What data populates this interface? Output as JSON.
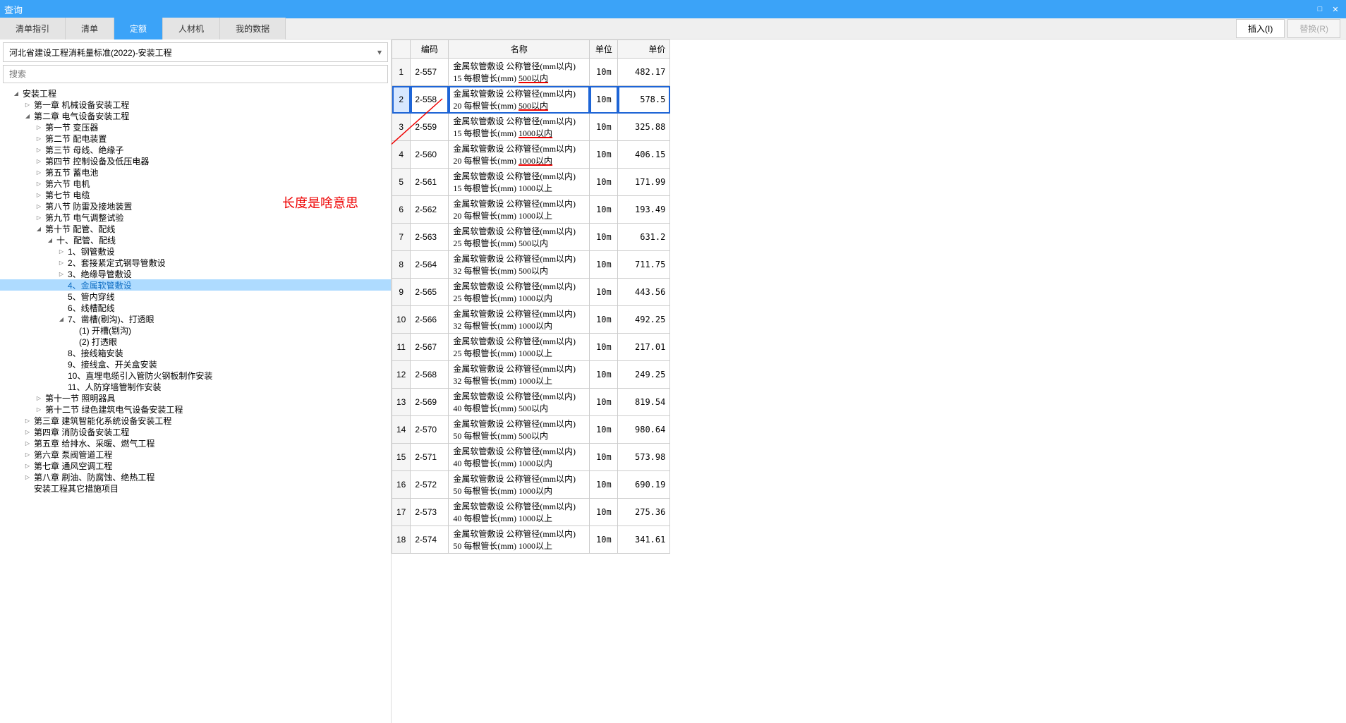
{
  "window": {
    "title": "查询"
  },
  "tabs": [
    "清单指引",
    "清单",
    "定额",
    "人材机",
    "我的数据"
  ],
  "active_tab": "定额",
  "actions": {
    "insert": "插入(I)",
    "replace": "替换(R)"
  },
  "dropdown": {
    "value": "河北省建设工程消耗量标准(2022)-安装工程"
  },
  "search": {
    "placeholder": "搜索"
  },
  "tree": [
    {
      "label": "安装工程",
      "depth": 0,
      "exp": true
    },
    {
      "label": "第一章 机械设备安装工程",
      "depth": 1,
      "exp": false
    },
    {
      "label": "第二章 电气设备安装工程",
      "depth": 1,
      "exp": true
    },
    {
      "label": "第一节 变压器",
      "depth": 2,
      "exp": false
    },
    {
      "label": "第二节 配电装置",
      "depth": 2,
      "exp": false
    },
    {
      "label": "第三节 母线、绝缘子",
      "depth": 2,
      "exp": false
    },
    {
      "label": "第四节 控制设备及低压电器",
      "depth": 2,
      "exp": false
    },
    {
      "label": "第五节 蓄电池",
      "depth": 2,
      "exp": false
    },
    {
      "label": "第六节 电机",
      "depth": 2,
      "exp": false
    },
    {
      "label": "第七节 电缆",
      "depth": 2,
      "exp": false
    },
    {
      "label": "第八节 防雷及接地装置",
      "depth": 2,
      "exp": false
    },
    {
      "label": "第九节 电气调整试验",
      "depth": 2,
      "exp": false
    },
    {
      "label": "第十节 配管、配线",
      "depth": 2,
      "exp": true
    },
    {
      "label": "十、配管、配线",
      "depth": 3,
      "exp": true
    },
    {
      "label": "1、钢管敷设",
      "depth": 4,
      "exp": false
    },
    {
      "label": "2、套接紧定式钢导管敷设",
      "depth": 4,
      "exp": false
    },
    {
      "label": "3、绝缘导管敷设",
      "depth": 4,
      "exp": false
    },
    {
      "label": "4、金属软管敷设",
      "depth": 4,
      "exp": false,
      "hl": true,
      "leaf": true
    },
    {
      "label": "5、管内穿线",
      "depth": 4,
      "exp": false,
      "leaf": true
    },
    {
      "label": "6、线槽配线",
      "depth": 4,
      "exp": false,
      "leaf": true
    },
    {
      "label": "7、凿槽(剔沟)、打透眼",
      "depth": 4,
      "exp": true
    },
    {
      "label": "(1) 开槽(剔沟)",
      "depth": 5,
      "exp": false,
      "leaf": true
    },
    {
      "label": "(2) 打透眼",
      "depth": 5,
      "exp": false,
      "leaf": true
    },
    {
      "label": "8、接线箱安装",
      "depth": 4,
      "exp": false,
      "leaf": true
    },
    {
      "label": "9、接线盒、开关盒安装",
      "depth": 4,
      "exp": false,
      "leaf": true
    },
    {
      "label": "10、直埋电缆引入管防火钢板制作安装",
      "depth": 4,
      "exp": false,
      "leaf": true
    },
    {
      "label": "11、人防穿墙管制作安装",
      "depth": 4,
      "exp": false,
      "leaf": true
    },
    {
      "label": "第十一节 照明器具",
      "depth": 2,
      "exp": false
    },
    {
      "label": "第十二节 绿色建筑电气设备安装工程",
      "depth": 2,
      "exp": false
    },
    {
      "label": "第三章 建筑智能化系统设备安装工程",
      "depth": 1,
      "exp": false
    },
    {
      "label": "第四章 消防设备安装工程",
      "depth": 1,
      "exp": false
    },
    {
      "label": "第五章 给排水、采暖、燃气工程",
      "depth": 1,
      "exp": false
    },
    {
      "label": "第六章 泵阀管道工程",
      "depth": 1,
      "exp": false
    },
    {
      "label": "第七章 通风空调工程",
      "depth": 1,
      "exp": false
    },
    {
      "label": "第八章 刷油、防腐蚀、绝热工程",
      "depth": 1,
      "exp": false
    },
    {
      "label": "安装工程其它措施项目",
      "depth": 1,
      "exp": false,
      "leaf": true
    }
  ],
  "table": {
    "headers": [
      "编码",
      "名称",
      "单位",
      "单价"
    ],
    "rows": [
      {
        "idx": 1,
        "code": "2-557",
        "name": "金属软管敷设 公称管径(mm以内) 15 每根管长(mm) ",
        "suffix": "500以内",
        "unit": "10m",
        "price": "482.17",
        "red": true
      },
      {
        "idx": 2,
        "code": "2-558",
        "name": "金属软管敷设 公称管径(mm以内) 20 每根管长(mm) ",
        "suffix": "500以内",
        "unit": "10m",
        "price": "578.5",
        "red": true,
        "sel": true
      },
      {
        "idx": 3,
        "code": "2-559",
        "name": "金属软管敷设 公称管径(mm以内) 15 每根管长(mm) ",
        "suffix": "1000以内",
        "unit": "10m",
        "price": "325.88",
        "red": true
      },
      {
        "idx": 4,
        "code": "2-560",
        "name": "金属软管敷设 公称管径(mm以内) 20 每根管长(mm) ",
        "suffix": "1000以内",
        "unit": "10m",
        "price": "406.15",
        "red": true
      },
      {
        "idx": 5,
        "code": "2-561",
        "name": "金属软管敷设 公称管径(mm以内) 15 每根管长(mm) ",
        "suffix": "1000以上",
        "unit": "10m",
        "price": "171.99"
      },
      {
        "idx": 6,
        "code": "2-562",
        "name": "金属软管敷设 公称管径(mm以内) 20 每根管长(mm) ",
        "suffix": "1000以上",
        "unit": "10m",
        "price": "193.49"
      },
      {
        "idx": 7,
        "code": "2-563",
        "name": "金属软管敷设 公称管径(mm以内) 25 每根管长(mm) ",
        "suffix": "500以内",
        "unit": "10m",
        "price": "631.2"
      },
      {
        "idx": 8,
        "code": "2-564",
        "name": "金属软管敷设 公称管径(mm以内) 32 每根管长(mm) ",
        "suffix": "500以内",
        "unit": "10m",
        "price": "711.75"
      },
      {
        "idx": 9,
        "code": "2-565",
        "name": "金属软管敷设 公称管径(mm以内) 25 每根管长(mm) ",
        "suffix": "1000以内",
        "unit": "10m",
        "price": "443.56"
      },
      {
        "idx": 10,
        "code": "2-566",
        "name": "金属软管敷设 公称管径(mm以内) 32 每根管长(mm) ",
        "suffix": "1000以内",
        "unit": "10m",
        "price": "492.25"
      },
      {
        "idx": 11,
        "code": "2-567",
        "name": "金属软管敷设 公称管径(mm以内) 25 每根管长(mm) ",
        "suffix": "1000以上",
        "unit": "10m",
        "price": "217.01"
      },
      {
        "idx": 12,
        "code": "2-568",
        "name": "金属软管敷设 公称管径(mm以内) 32 每根管长(mm) ",
        "suffix": "1000以上",
        "unit": "10m",
        "price": "249.25"
      },
      {
        "idx": 13,
        "code": "2-569",
        "name": "金属软管敷设 公称管径(mm以内) 40 每根管长(mm) ",
        "suffix": "500以内",
        "unit": "10m",
        "price": "819.54"
      },
      {
        "idx": 14,
        "code": "2-570",
        "name": "金属软管敷设 公称管径(mm以内) 50 每根管长(mm) ",
        "suffix": "500以内",
        "unit": "10m",
        "price": "980.64"
      },
      {
        "idx": 15,
        "code": "2-571",
        "name": "金属软管敷设 公称管径(mm以内) 40 每根管长(mm) ",
        "suffix": "1000以内",
        "unit": "10m",
        "price": "573.98"
      },
      {
        "idx": 16,
        "code": "2-572",
        "name": "金属软管敷设 公称管径(mm以内) 50 每根管长(mm) ",
        "suffix": "1000以内",
        "unit": "10m",
        "price": "690.19"
      },
      {
        "idx": 17,
        "code": "2-573",
        "name": "金属软管敷设 公称管径(mm以内) 40 每根管长(mm) ",
        "suffix": "1000以上",
        "unit": "10m",
        "price": "275.36"
      },
      {
        "idx": 18,
        "code": "2-574",
        "name": "金属软管敷设 公称管径(mm以内) 50 每根管长(mm) ",
        "suffix": "1000以上",
        "unit": "10m",
        "price": "341.61"
      }
    ]
  },
  "annotation": "长度是啥意思"
}
